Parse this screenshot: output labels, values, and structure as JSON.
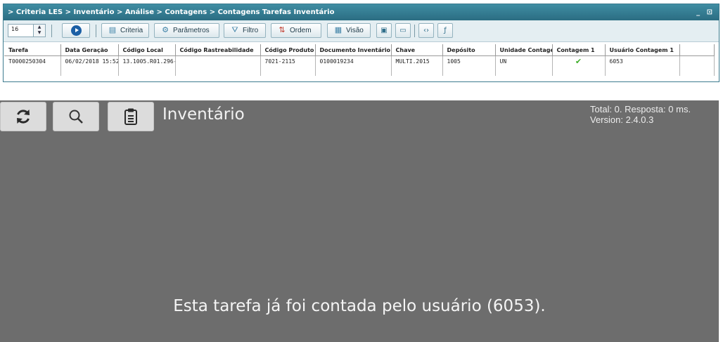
{
  "window": {
    "breadcrumb": "> Criteria LES > Inventário > Análise > Contagens > Contagens Tarefas Inventário",
    "controls": "_ ⊡"
  },
  "toolbar": {
    "page_size": "16",
    "buttons": {
      "criteria": "Criteria",
      "parametros": "Parâmetros",
      "filtro": "Filtro",
      "ordem": "Ordem",
      "visao": "Visão"
    },
    "icons": [
      "go-icon",
      "export-icon",
      "save-icon",
      "code-icon",
      "function-icon"
    ]
  },
  "table": {
    "columns": [
      "Tarefa",
      "Data Geração",
      "Código Local",
      "Código Rastreabilidade",
      "Código Produto",
      "Documento Inventário",
      "Chave",
      "Depósito",
      "Unidade Contagem",
      "Contagem 1",
      "Usuário Contagem 1"
    ],
    "rows": [
      [
        "T0000250304",
        "06/02/2018 15:52:",
        "13.1005.R01.296-",
        "",
        "7021-2115",
        "0100019234",
        "MULTI.2015",
        "1005",
        "UN",
        "✔",
        "6053"
      ]
    ]
  },
  "mobile": {
    "title": "Inventário",
    "status_line1": "Total: 0. Resposta: 0 ms.",
    "status_line2": "Version: 2.4.0.3",
    "message": "Esta tarefa já foi contada pelo usuário (6053).",
    "buttons": [
      "refresh-icon",
      "search-icon",
      "clipboard-icon"
    ]
  },
  "colors": {
    "titlebar": "#2f7489",
    "mobile_bg": "#6d6d6d",
    "check": "#3fae2a"
  }
}
